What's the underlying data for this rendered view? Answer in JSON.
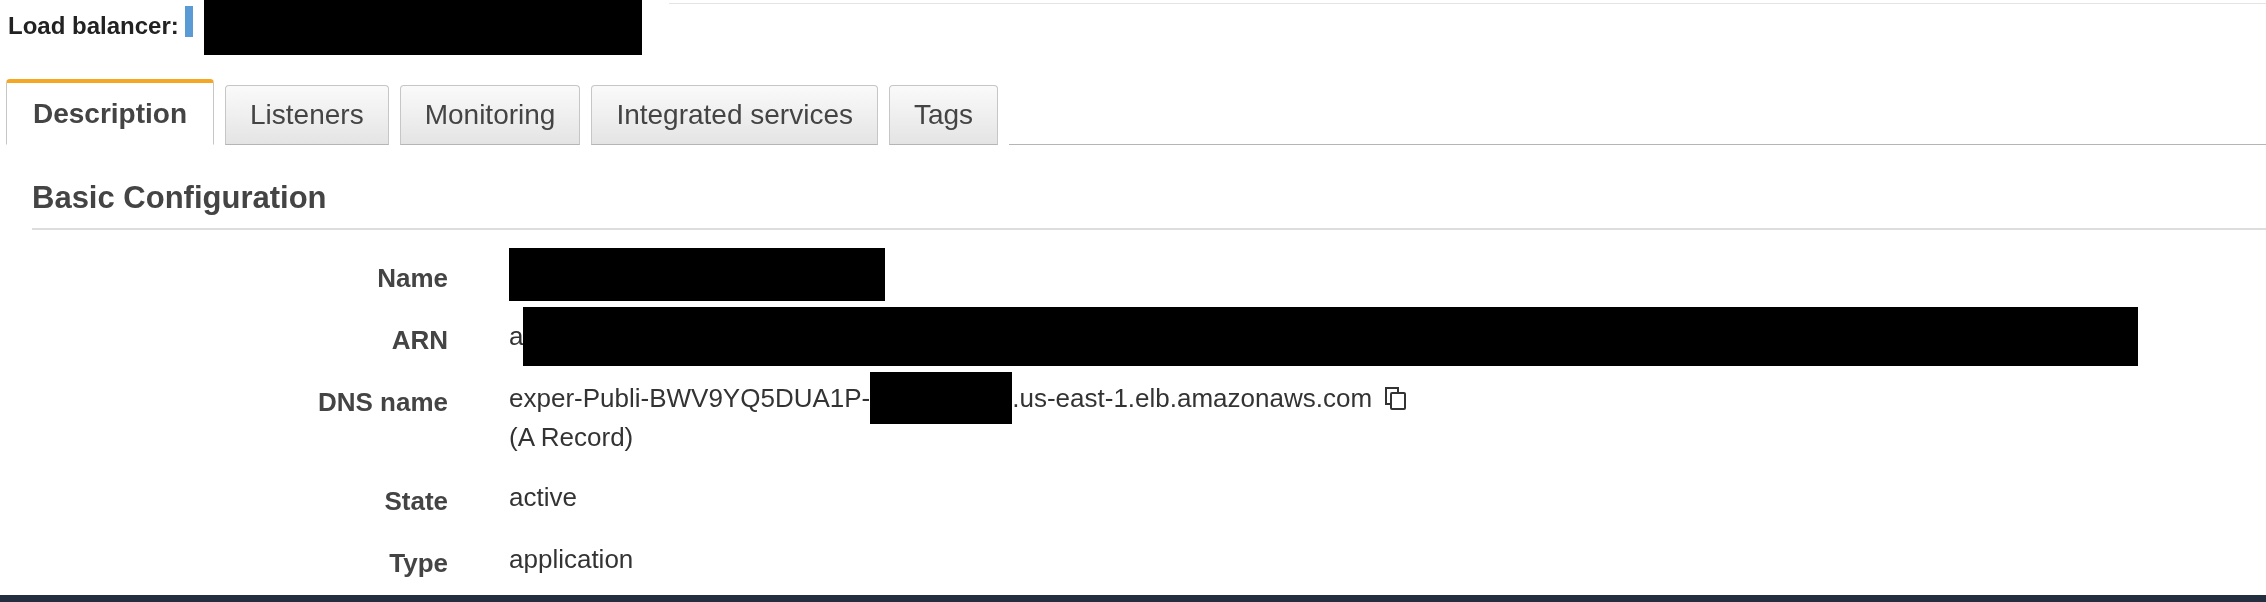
{
  "header": {
    "label": "Load balancer:",
    "redacted": true
  },
  "tabs": [
    {
      "label": "Description",
      "selected": true
    },
    {
      "label": "Listeners",
      "selected": false
    },
    {
      "label": "Monitoring",
      "selected": false
    },
    {
      "label": "Integrated services",
      "selected": false
    },
    {
      "label": "Tags",
      "selected": false
    }
  ],
  "section": {
    "title": "Basic Configuration"
  },
  "fields": [
    {
      "label": "Name",
      "segments": [
        {
          "kind": "redacted"
        }
      ]
    },
    {
      "label": "ARN",
      "segments": [
        {
          "kind": "text",
          "text": "a"
        },
        {
          "kind": "redacted"
        }
      ]
    },
    {
      "label": "DNS name",
      "segments": [
        {
          "kind": "text",
          "text": "exper-Publi-BWV9YQ5DUA1P-"
        },
        {
          "kind": "redacted"
        },
        {
          "kind": "text",
          "text": ".us-east-1.elb.amazonaws.com"
        },
        {
          "kind": "copy"
        }
      ],
      "note": "(A Record)"
    },
    {
      "label": "State",
      "segments": [
        {
          "kind": "text",
          "text": "active"
        }
      ]
    },
    {
      "label": "Type",
      "segments": [
        {
          "kind": "text",
          "text": "application"
        }
      ]
    }
  ]
}
